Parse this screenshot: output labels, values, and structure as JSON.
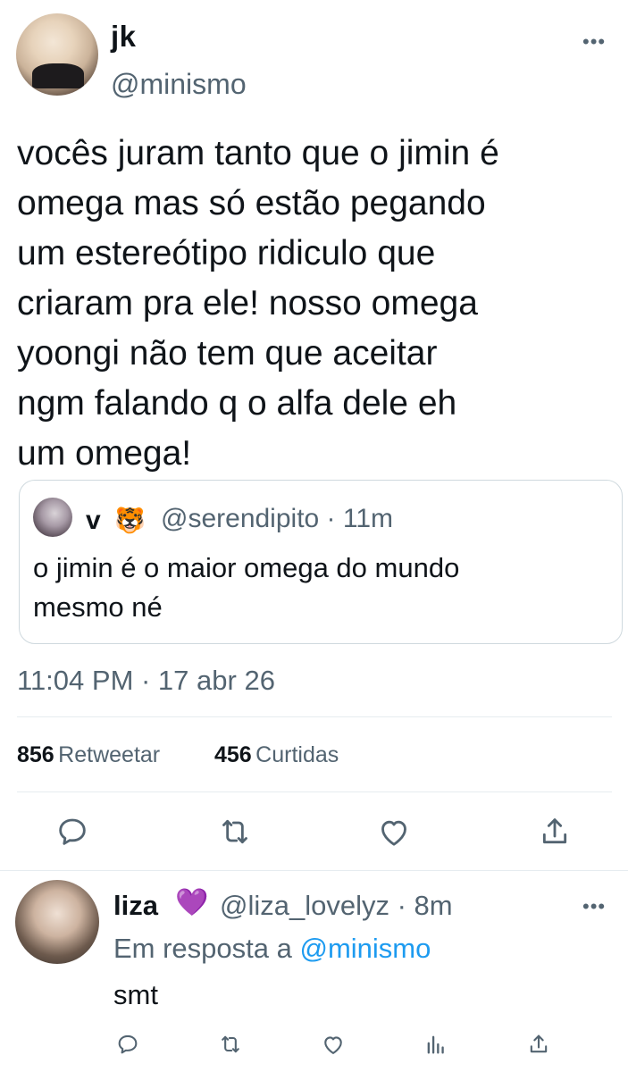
{
  "tweet": {
    "author_name": "jk",
    "author_handle": "@minismo",
    "more_label": "•••",
    "text": "vocês juram tanto que o jimin é\nomega mas só estão pegando\num estereótipo ridiculo que\ncriaram pra ele! nosso omega\nyoongi não tem que aceitar\nngm falando q o alfa dele eh\num omega!",
    "timestamp": "11:04 PM · 17 abr 26",
    "stats": {
      "retweets_count": "856",
      "retweets_label": "Retweetar",
      "likes_count": "456",
      "likes_label": "Curtidas"
    }
  },
  "quote": {
    "author_name": "v",
    "author_emoji": "🐯",
    "handle_time": "@serendipito · 11m",
    "text": "o jimin é o maior omega do mundo\nmesmo né"
  },
  "reply": {
    "author_name": "liza",
    "author_emoji": "💜",
    "handle_time": "@liza_lovelyz · 8m",
    "reply_prefix": "Em resposta a",
    "reply_to_handle": "@minismo",
    "text": "smt",
    "more_label": "•••"
  },
  "icons": {
    "reply": "reply-icon",
    "retweet": "retweet-icon",
    "like": "heart-icon",
    "share": "share-icon",
    "analytics": "analytics-icon"
  },
  "colors": {
    "text": "#0f1419",
    "secondary": "#536471",
    "link": "#1d9bf0",
    "border": "#cfd9de",
    "heart_purple": "#9b5de5"
  }
}
